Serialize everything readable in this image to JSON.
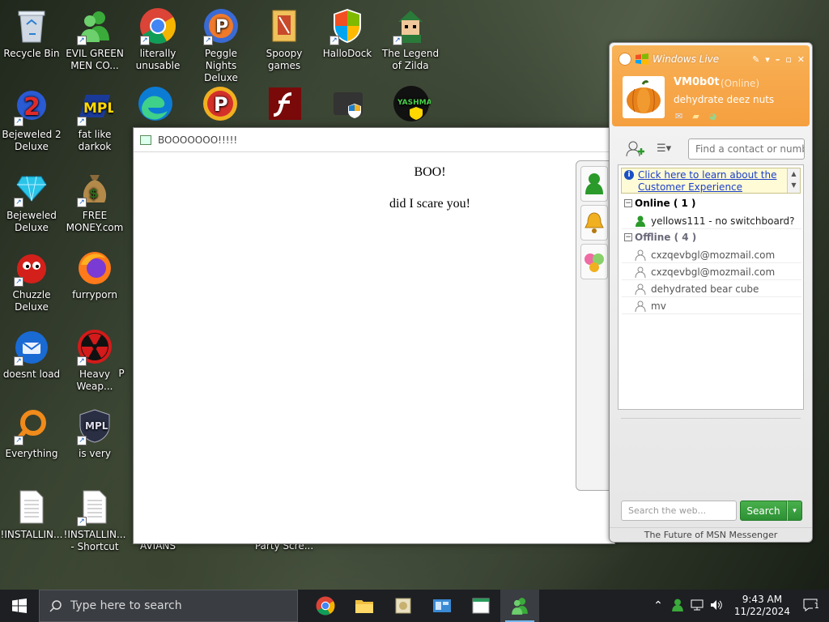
{
  "desktop": {
    "icons": [
      {
        "label": "Recycle Bin",
        "icon": "recycle-bin-icon"
      },
      {
        "label": "EVIL GREEN MEN CO...",
        "icon": "green-men-icon"
      },
      {
        "label": "literally unusable",
        "icon": "chrome-icon"
      },
      {
        "label": "Peggle Nights Deluxe",
        "icon": "peggle-icon"
      },
      {
        "label": "Spoopy games",
        "icon": "folder-icon"
      },
      {
        "label": "HalloDock",
        "icon": "windows-shield-icon"
      },
      {
        "label": "The Legend of Zilda",
        "icon": "zilda-icon"
      },
      {
        "label": "Bejeweled 2 Deluxe",
        "icon": "bejeweled2-icon"
      },
      {
        "label": "fat like darkok",
        "icon": "mpl-icon"
      },
      {
        "label": "Bejeweled Deluxe",
        "icon": "gem-icon"
      },
      {
        "label": "FREE MONEY.com",
        "icon": "money-bag-icon"
      },
      {
        "label": "Chuzzle Deluxe",
        "icon": "chuzzle-icon"
      },
      {
        "label": "furryporn",
        "icon": "firefox-icon"
      },
      {
        "label": "doesnt load",
        "icon": "thunderbird-icon"
      },
      {
        "label": "Heavy Weap...",
        "icon": "radiation-icon"
      },
      {
        "label": "Everything",
        "icon": "everything-icon"
      },
      {
        "label": "is very",
        "icon": "mpl-shield-icon"
      },
      {
        "label": "!INSTALLIN...",
        "icon": "document-icon"
      },
      {
        "label": "!INSTALLIN... - Shortcut",
        "icon": "document-icon"
      }
    ],
    "partial_labels": [
      "AVIANS",
      "Party Scre...",
      "P"
    ]
  },
  "boo_window": {
    "title": "BOOOOOOO!!!!!",
    "heading": "BOO!",
    "body": "did I scare you!"
  },
  "msn": {
    "brand": "Windows Live",
    "display_name": "VM0b0t",
    "status": "(Online)",
    "personal_message": "dehydrate deez nuts",
    "find_placeholder": "Find a contact or number",
    "banner_link": "Click here to learn about the Customer Experience",
    "groups": {
      "online": {
        "label": "Online ( 1 )",
        "contacts": [
          "yellows111 - no switchboard?"
        ]
      },
      "offline": {
        "label": "Offline ( 4 )",
        "contacts": [
          "cxzqevbgl@mozmail.com",
          "cxzqevbgl@mozmail.com",
          "dehydrated bear cube",
          "mv"
        ]
      }
    },
    "web_search_placeholder": "Search the web...",
    "search_button": "Search",
    "footer": "The Future of MSN Messenger"
  },
  "taskbar": {
    "search_placeholder": "Type here to search",
    "time": "9:43 AM",
    "date": "11/22/2024",
    "notification_count": "1"
  },
  "colors": {
    "msn_orange": "#f7a94c",
    "search_green": "#2d9135",
    "link_blue": "#1b3fc9"
  }
}
